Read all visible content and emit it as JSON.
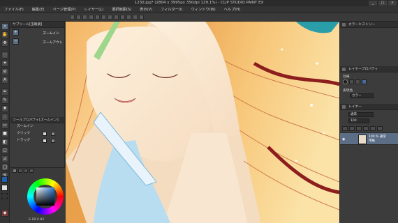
{
  "app": {
    "title": "1230.jpg* (2804 x 3995px 350dpi 129.1%) - CLIP STUDIO PAINT EX",
    "window_buttons": [
      "_",
      "□",
      "×"
    ]
  },
  "menu": [
    "ファイル(F)",
    "編集(E)",
    "ページ管理(P)",
    "レイヤー(L)",
    "選択範囲(S)",
    "表示(V)",
    "フィルター(I)",
    "ウィンドウ(W)",
    "ヘルプ(H)"
  ],
  "tools": [
    "zoom-icon",
    "hand-icon",
    "move-icon",
    "lasso-icon",
    "eyedropper-icon",
    "pen-icon",
    "pencil-icon",
    "brush-icon",
    "airbrush-icon",
    "blend-icon",
    "eraser-icon",
    "fill-icon",
    "gradient-icon",
    "text-icon",
    "figure-icon",
    "ruler-icon",
    "balloon-icon",
    "correction-icon"
  ],
  "subtool": {
    "title": "サブツール[虫眼鏡]",
    "items": [
      {
        "icon": "zoom-in-icon",
        "label": "ズームイン"
      },
      {
        "icon": "zoom-out-icon",
        "label": "ズームアウト"
      }
    ]
  },
  "tool_property": {
    "title": "ツールプロパティ[ズームイン]",
    "subtitle": "ズームイン",
    "rows": [
      "クリック",
      "ドラッグ"
    ]
  },
  "color_panel": {
    "value_text": "S 18  V 82"
  },
  "right_panel": {
    "color_history_title": "カラーヒストリー",
    "layer_property_title": "レイヤープロパティ",
    "effect_label": "効果",
    "expression_label": "表現色",
    "expression_value": "カラー",
    "layer_panel_title": "レイヤー",
    "blend_mode": "通常",
    "opacity": "100",
    "layer": {
      "opacity_line": "100 % 通常",
      "name_line": "用紙"
    }
  },
  "colors": {
    "accent": "#5b6e86",
    "panel_bg": "#3c3c3c",
    "title_bg": "#2b2b2b",
    "main_color": "#1f5fb0",
    "sub_color": "#e0e0e0"
  }
}
